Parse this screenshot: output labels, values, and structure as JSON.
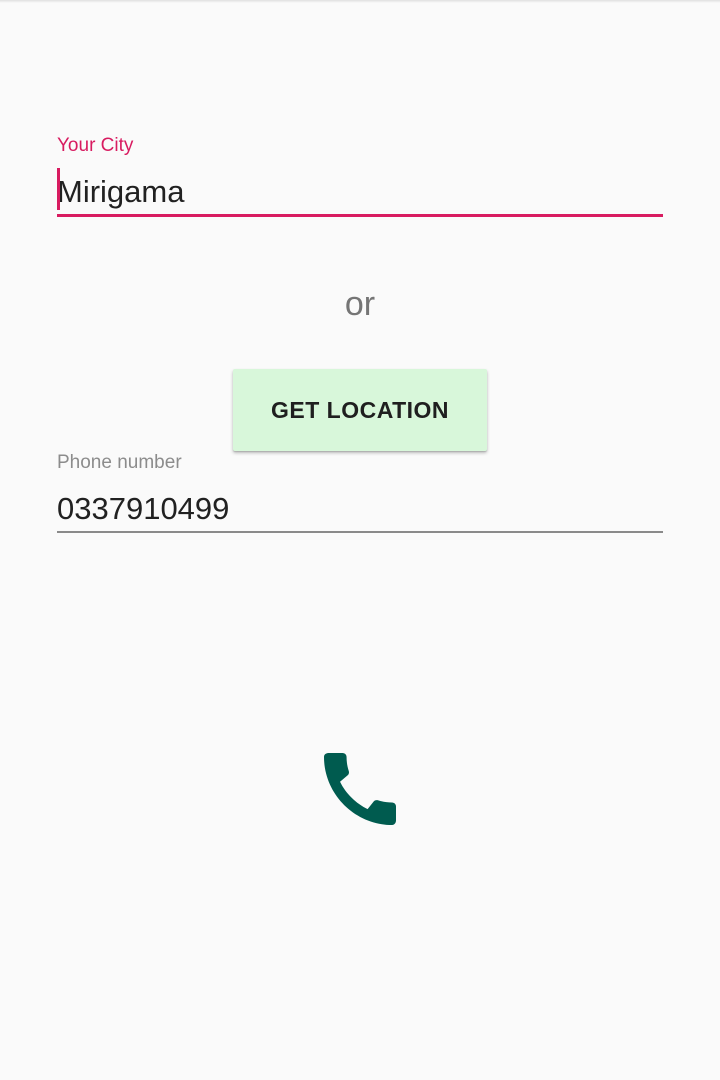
{
  "city_field": {
    "label": "Your City",
    "value": "Mirigama"
  },
  "separator_text": "or",
  "location_button": {
    "label": "GET LOCATION"
  },
  "phone_field": {
    "label": "Phone number",
    "value": "0337910499"
  },
  "call_button": {
    "icon": "phone-icon",
    "color": "#005b4f"
  },
  "colors": {
    "accent": "#d81b60",
    "background": "#fafafa",
    "button_background": "#d8f7da",
    "hint_text": "#8c8c8c"
  }
}
